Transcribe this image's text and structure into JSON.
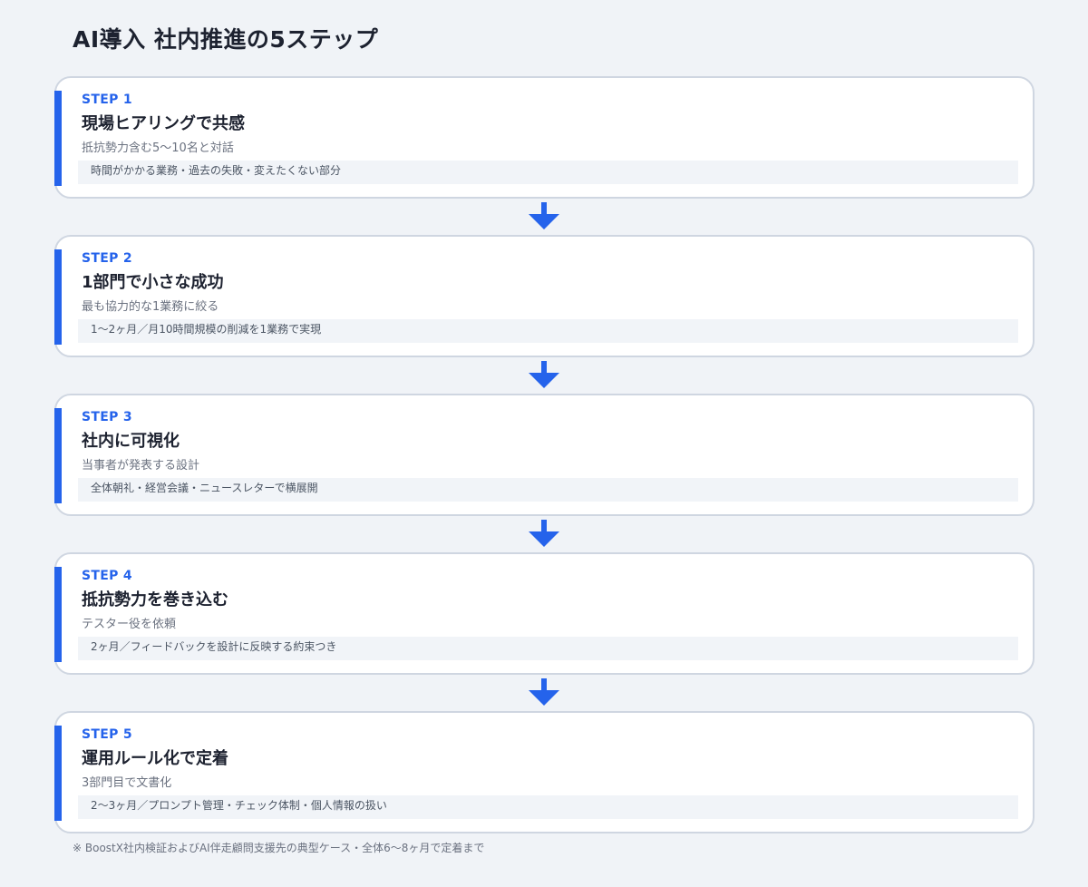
{
  "title": "AI導入 社内推進の5ステップ",
  "colors": {
    "accent": "#2563eb",
    "background": "#f0f3f7",
    "card": "#ffffff",
    "card_border": "#cfd6e1",
    "detail_bg": "#f1f4f8"
  },
  "steps": [
    {
      "label": "STEP 1",
      "title": "現場ヒアリングで共感",
      "sub": "抵抗勢力含む5〜10名と対話",
      "detail": "時間がかかる業務・過去の失敗・変えたくない部分"
    },
    {
      "label": "STEP 2",
      "title": "1部門で小さな成功",
      "sub": "最も協力的な1業務に絞る",
      "detail": "1〜2ヶ月／月10時間規模の削減を1業務で実現"
    },
    {
      "label": "STEP 3",
      "title": "社内に可視化",
      "sub": "当事者が発表する設計",
      "detail": "全体朝礼・経営会議・ニュースレターで横展開"
    },
    {
      "label": "STEP 4",
      "title": "抵抗勢力を巻き込む",
      "sub": "テスター役を依頼",
      "detail": "2ヶ月／フィードバックを設計に反映する約束つき"
    },
    {
      "label": "STEP 5",
      "title": "運用ルール化で定着",
      "sub": "3部門目で文書化",
      "detail": "2〜3ヶ月／プロンプト管理・チェック体制・個人情報の扱い"
    }
  ],
  "arrow_icon": "arrow-down-icon",
  "footnote": "※ BoostX社内検証およびAI伴走顧問支援先の典型ケース・全体6〜8ヶ月で定着まで"
}
